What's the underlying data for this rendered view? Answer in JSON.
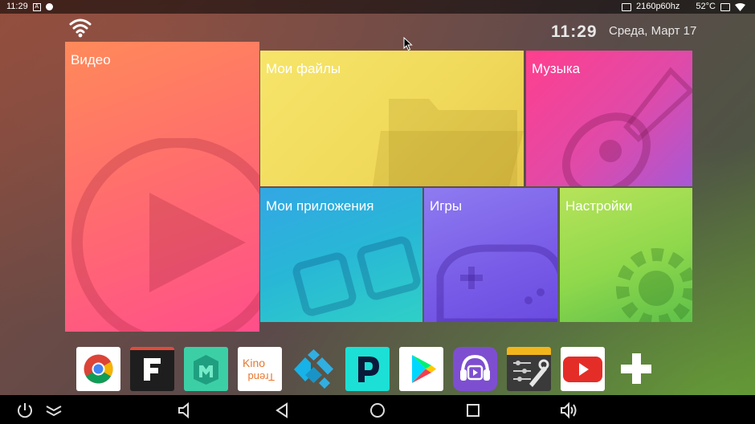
{
  "status_bar": {
    "time": "11:29",
    "resolution": "2160p60hz",
    "temperature": "52°C",
    "icons": [
      "a-box-icon",
      "record-dot-icon",
      "picture-icon",
      "screen-icon",
      "wifi-icon"
    ]
  },
  "header": {
    "clock": "11:29",
    "date": "Среда, Март 17"
  },
  "tiles": {
    "video": "Видео",
    "files": "Мои файлы",
    "music": "Музыка",
    "apps": "Мои приложения",
    "games": "Игры",
    "settings": "Настройки"
  },
  "dock": {
    "apps": [
      {
        "name": "chrome",
        "icon": "chrome-icon"
      },
      {
        "name": "F",
        "icon": "f-app-icon"
      },
      {
        "name": "store",
        "icon": "m-app-icon"
      },
      {
        "name": "Kino Trend",
        "icon": "kino-trend-icon"
      },
      {
        "name": "kodi",
        "icon": "kodi-icon"
      },
      {
        "name": "P",
        "icon": "p-app-icon"
      },
      {
        "name": "play store",
        "icon": "play-store-icon"
      },
      {
        "name": "media",
        "icon": "headphone-player-icon"
      },
      {
        "name": "tools",
        "icon": "tools-icon"
      },
      {
        "name": "youtube",
        "icon": "youtube-icon"
      },
      {
        "name": "add",
        "icon": "plus-icon"
      }
    ],
    "kino_text": "Kino Trend"
  },
  "navbar": {
    "icons": [
      "power-icon",
      "menu-chevrons-icon",
      "volume-down-icon",
      "back-icon",
      "home-icon",
      "recents-icon",
      "volume-up-icon"
    ]
  },
  "colors": {
    "video": "#ff6f6c",
    "files": "#f0d95a",
    "music": "#e04aa8",
    "apps": "#28b7d6",
    "games": "#7a5ee8",
    "settings": "#8fd84c"
  }
}
